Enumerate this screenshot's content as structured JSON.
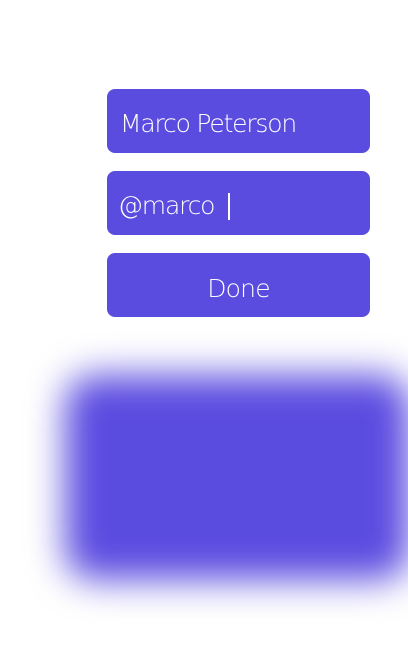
{
  "form": {
    "name_value": "Marco Peterson",
    "handle_value": "@marco",
    "done_label": "Done"
  },
  "colors": {
    "accent": "#5b4ce0",
    "text": "#ffffff",
    "background": "#ffffff"
  }
}
